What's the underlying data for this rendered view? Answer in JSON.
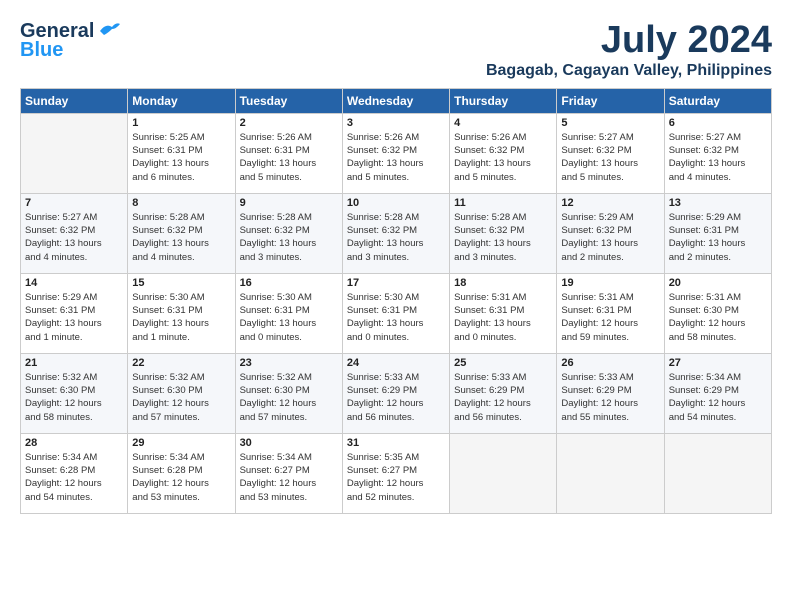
{
  "header": {
    "logo_line1": "General",
    "logo_line2": "Blue",
    "month": "July 2024",
    "location": "Bagagab, Cagayan Valley, Philippines"
  },
  "weekdays": [
    "Sunday",
    "Monday",
    "Tuesday",
    "Wednesday",
    "Thursday",
    "Friday",
    "Saturday"
  ],
  "weeks": [
    [
      {
        "day": "",
        "info": ""
      },
      {
        "day": "1",
        "info": "Sunrise: 5:25 AM\nSunset: 6:31 PM\nDaylight: 13 hours\nand 6 minutes."
      },
      {
        "day": "2",
        "info": "Sunrise: 5:26 AM\nSunset: 6:31 PM\nDaylight: 13 hours\nand 5 minutes."
      },
      {
        "day": "3",
        "info": "Sunrise: 5:26 AM\nSunset: 6:32 PM\nDaylight: 13 hours\nand 5 minutes."
      },
      {
        "day": "4",
        "info": "Sunrise: 5:26 AM\nSunset: 6:32 PM\nDaylight: 13 hours\nand 5 minutes."
      },
      {
        "day": "5",
        "info": "Sunrise: 5:27 AM\nSunset: 6:32 PM\nDaylight: 13 hours\nand 5 minutes."
      },
      {
        "day": "6",
        "info": "Sunrise: 5:27 AM\nSunset: 6:32 PM\nDaylight: 13 hours\nand 4 minutes."
      }
    ],
    [
      {
        "day": "7",
        "info": "Sunrise: 5:27 AM\nSunset: 6:32 PM\nDaylight: 13 hours\nand 4 minutes."
      },
      {
        "day": "8",
        "info": "Sunrise: 5:28 AM\nSunset: 6:32 PM\nDaylight: 13 hours\nand 4 minutes."
      },
      {
        "day": "9",
        "info": "Sunrise: 5:28 AM\nSunset: 6:32 PM\nDaylight: 13 hours\nand 3 minutes."
      },
      {
        "day": "10",
        "info": "Sunrise: 5:28 AM\nSunset: 6:32 PM\nDaylight: 13 hours\nand 3 minutes."
      },
      {
        "day": "11",
        "info": "Sunrise: 5:28 AM\nSunset: 6:32 PM\nDaylight: 13 hours\nand 3 minutes."
      },
      {
        "day": "12",
        "info": "Sunrise: 5:29 AM\nSunset: 6:32 PM\nDaylight: 13 hours\nand 2 minutes."
      },
      {
        "day": "13",
        "info": "Sunrise: 5:29 AM\nSunset: 6:31 PM\nDaylight: 13 hours\nand 2 minutes."
      }
    ],
    [
      {
        "day": "14",
        "info": "Sunrise: 5:29 AM\nSunset: 6:31 PM\nDaylight: 13 hours\nand 1 minute."
      },
      {
        "day": "15",
        "info": "Sunrise: 5:30 AM\nSunset: 6:31 PM\nDaylight: 13 hours\nand 1 minute."
      },
      {
        "day": "16",
        "info": "Sunrise: 5:30 AM\nSunset: 6:31 PM\nDaylight: 13 hours\nand 0 minutes."
      },
      {
        "day": "17",
        "info": "Sunrise: 5:30 AM\nSunset: 6:31 PM\nDaylight: 13 hours\nand 0 minutes."
      },
      {
        "day": "18",
        "info": "Sunrise: 5:31 AM\nSunset: 6:31 PM\nDaylight: 13 hours\nand 0 minutes."
      },
      {
        "day": "19",
        "info": "Sunrise: 5:31 AM\nSunset: 6:31 PM\nDaylight: 12 hours\nand 59 minutes."
      },
      {
        "day": "20",
        "info": "Sunrise: 5:31 AM\nSunset: 6:30 PM\nDaylight: 12 hours\nand 58 minutes."
      }
    ],
    [
      {
        "day": "21",
        "info": "Sunrise: 5:32 AM\nSunset: 6:30 PM\nDaylight: 12 hours\nand 58 minutes."
      },
      {
        "day": "22",
        "info": "Sunrise: 5:32 AM\nSunset: 6:30 PM\nDaylight: 12 hours\nand 57 minutes."
      },
      {
        "day": "23",
        "info": "Sunrise: 5:32 AM\nSunset: 6:30 PM\nDaylight: 12 hours\nand 57 minutes."
      },
      {
        "day": "24",
        "info": "Sunrise: 5:33 AM\nSunset: 6:29 PM\nDaylight: 12 hours\nand 56 minutes."
      },
      {
        "day": "25",
        "info": "Sunrise: 5:33 AM\nSunset: 6:29 PM\nDaylight: 12 hours\nand 56 minutes."
      },
      {
        "day": "26",
        "info": "Sunrise: 5:33 AM\nSunset: 6:29 PM\nDaylight: 12 hours\nand 55 minutes."
      },
      {
        "day": "27",
        "info": "Sunrise: 5:34 AM\nSunset: 6:29 PM\nDaylight: 12 hours\nand 54 minutes."
      }
    ],
    [
      {
        "day": "28",
        "info": "Sunrise: 5:34 AM\nSunset: 6:28 PM\nDaylight: 12 hours\nand 54 minutes."
      },
      {
        "day": "29",
        "info": "Sunrise: 5:34 AM\nSunset: 6:28 PM\nDaylight: 12 hours\nand 53 minutes."
      },
      {
        "day": "30",
        "info": "Sunrise: 5:34 AM\nSunset: 6:27 PM\nDaylight: 12 hours\nand 53 minutes."
      },
      {
        "day": "31",
        "info": "Sunrise: 5:35 AM\nSunset: 6:27 PM\nDaylight: 12 hours\nand 52 minutes."
      },
      {
        "day": "",
        "info": ""
      },
      {
        "day": "",
        "info": ""
      },
      {
        "day": "",
        "info": ""
      }
    ]
  ]
}
